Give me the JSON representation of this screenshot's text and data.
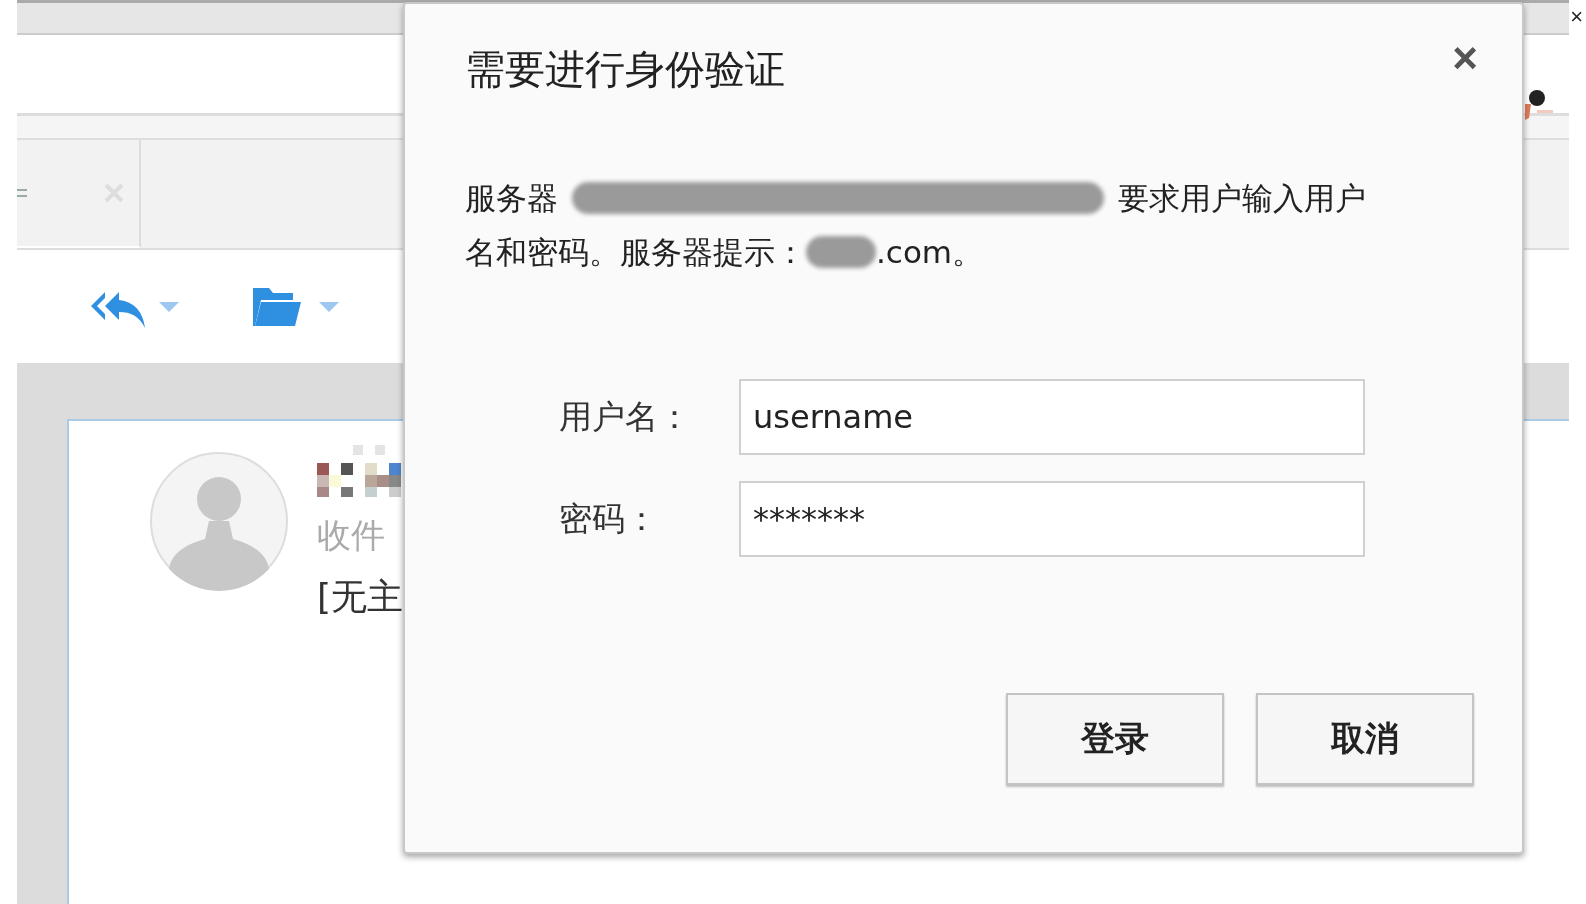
{
  "app": {
    "recipient_label": "收件",
    "subject": "[无主",
    "window_close": "×"
  },
  "dialog": {
    "title": "需要进行身份验证",
    "close": "×",
    "message_lines": [
      [
        {
          "kind": "text",
          "text": "服务器"
        },
        {
          "kind": "redacted"
        },
        {
          "kind": "text",
          "text": "要求用户输入用户"
        }
      ],
      [
        {
          "kind": "text",
          "text": "名和密码。服务器提示："
        },
        {
          "kind": "redacted"
        },
        {
          "kind": "text",
          "text": ".com。"
        }
      ]
    ],
    "fields": [
      {
        "label": "用户名：",
        "value": "username"
      },
      {
        "label": "密码：",
        "value": "*******"
      }
    ],
    "buttons": [
      "登录",
      "取消"
    ]
  }
}
